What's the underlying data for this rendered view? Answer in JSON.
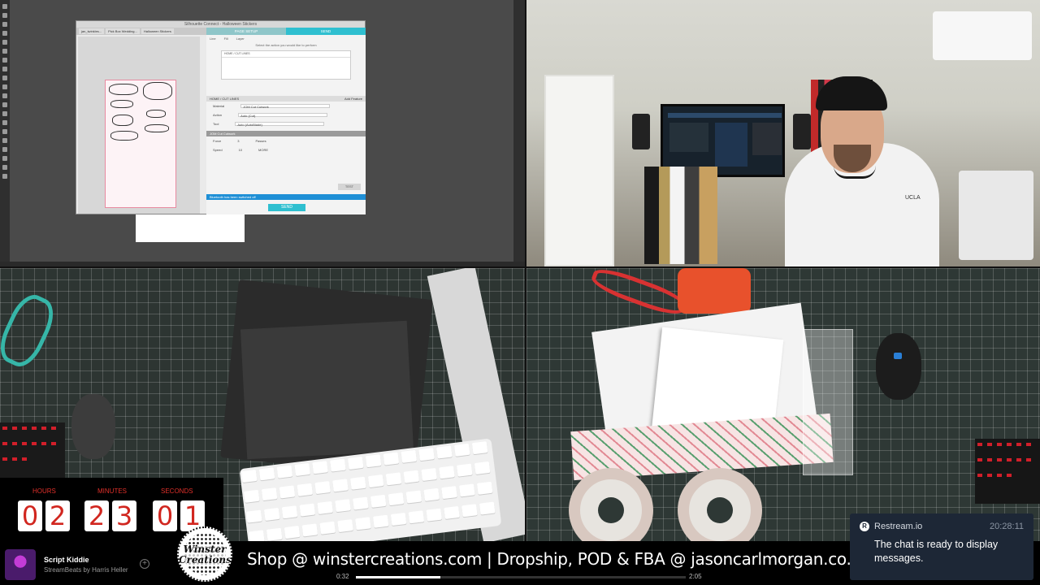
{
  "silhouette": {
    "window_title": "Silhouette Connect - Halloween Stickers",
    "doc_tabs": [
      "jan_twinkles...",
      "Pick Box Wedding...",
      "Halloween Stickers"
    ],
    "header_tabs": [
      "PAGE SETUP",
      "SEND"
    ],
    "sub_tabs": [
      "Line",
      "Fill",
      "Layer"
    ],
    "instruction": "Select the action you would like to perform",
    "table_row": "HOME / CUT LINES",
    "material_header": "HOME / CUT LINES",
    "add_button": "Add Feature",
    "fields": [
      {
        "label": "Material",
        "value": "JOM Cut Cutwork"
      },
      {
        "label": "Action",
        "value": "Auto (Cut)"
      },
      {
        "label": "Tool",
        "value": "Auto (AutoBlade)"
      }
    ],
    "cut_header": "JOM Cut Cutwork",
    "force_label": "Force",
    "speed_label": "Speed",
    "force_value": "3",
    "speed_value": "10",
    "passes_label": "Passes",
    "more_label": "MORE",
    "status": "Bluetooth has been switched off",
    "test_label": "TEST",
    "send_label": "SEND"
  },
  "timer": {
    "labels": {
      "hours": "HOURS",
      "minutes": "MINUTES",
      "seconds": "SECONDS"
    },
    "digits": [
      "0",
      "2",
      "2",
      "3",
      "0",
      "1"
    ]
  },
  "music": {
    "title": "Script Kiddie",
    "artist": "StreamBeats by Harris Heller",
    "elapsed": "0:32",
    "total": "2:05",
    "progress": 0.255
  },
  "badge_text": "Winster Creations",
  "ticker": "Shop @ winstercreations.com | Dropship, POD & FBA @ jasoncarlmorgan.co.uk",
  "chat": {
    "source": "Restream.io",
    "time": "20:28:11",
    "message": "The chat is ready to display messages."
  },
  "person_logo": "UCLA",
  "colors": {
    "accent": "#2fbfd0",
    "timer_red": "#d1261f",
    "chat_bg": "#1d2736"
  }
}
